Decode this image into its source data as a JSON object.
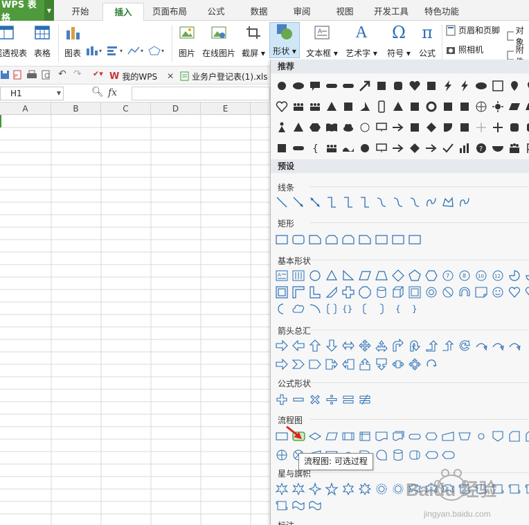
{
  "app": {
    "name": "WPS 表格"
  },
  "tabs": [
    {
      "label": "开始",
      "active": false
    },
    {
      "label": "插入",
      "active": true
    },
    {
      "label": "页面布局",
      "active": false
    },
    {
      "label": "公式",
      "active": false
    },
    {
      "label": "数据",
      "active": false
    },
    {
      "label": "审阅",
      "active": false
    },
    {
      "label": "视图",
      "active": false
    },
    {
      "label": "开发工具",
      "active": false
    },
    {
      "label": "特色功能",
      "active": false
    }
  ],
  "ribbon": {
    "pivot": "数据透视表",
    "table": "表格",
    "chart": "图表",
    "picture": "图片",
    "online_picture": "在线图片",
    "screenshot": "截屏",
    "shape": "形状",
    "textbox": "文本框",
    "wordart": "艺术字",
    "symbol": "符号",
    "formula": "公式",
    "header_footer": "页眉和页脚",
    "camera": "照相机",
    "object": "对象",
    "attachment": "附件"
  },
  "quickbar": {
    "tab1": "我的WPS",
    "tab2": "业务户登记表(1).xls"
  },
  "formula_bar": {
    "cell": "H1",
    "fx": "fx"
  },
  "columns": [
    "A",
    "B",
    "C",
    "D",
    "E"
  ],
  "shapes_menu": {
    "recommended": "推荐",
    "presets": "预设",
    "lines": "线条",
    "rectangles": "矩形",
    "basic": "基本形状",
    "arrows": "箭头总汇",
    "equation": "公式形状",
    "flowchart": "流程图",
    "stars": "星与旗帜",
    "callouts": "标注"
  },
  "tooltip": "流程图: 可选过程",
  "watermark": {
    "text": "Baidu 经验",
    "url": "jingyan.baidu.com"
  },
  "colors": {
    "accent": "#4f9a3c",
    "selected": "#cfe6f7",
    "shape_stroke": "#2a6fb4",
    "header_bg": "#e6e9ee",
    "active_cell": "#3b9a35",
    "arrow": "#e02020"
  }
}
